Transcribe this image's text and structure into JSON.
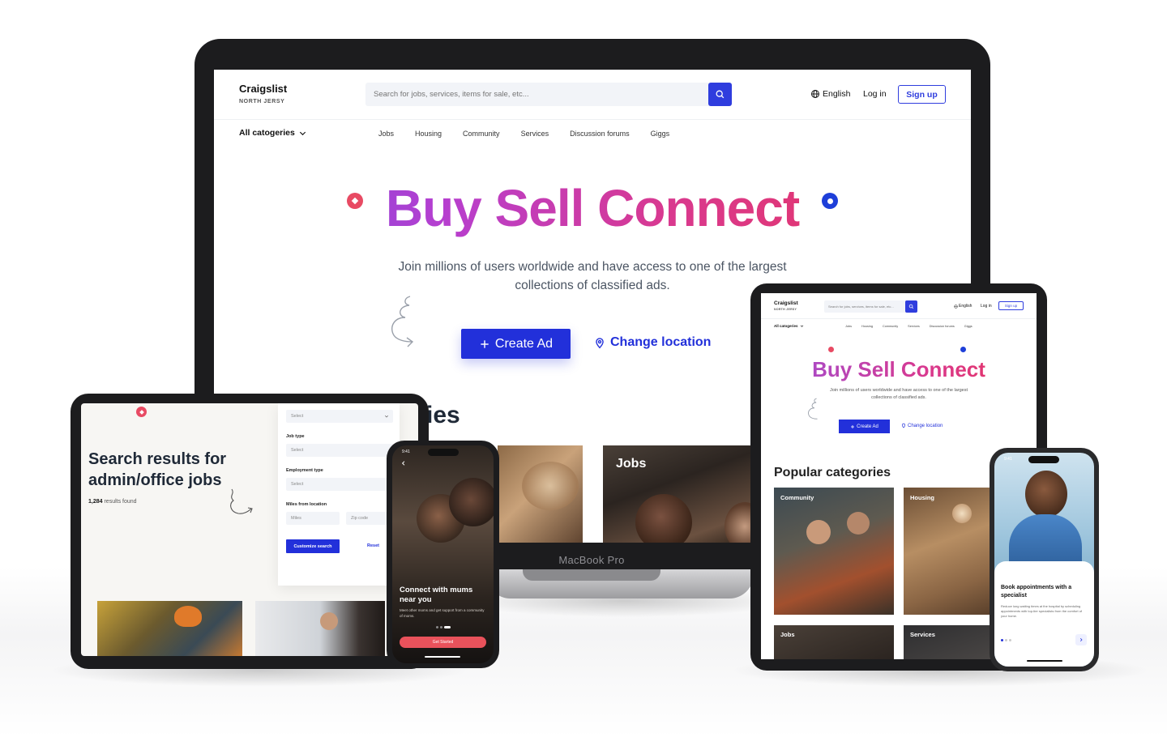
{
  "desktop": {
    "brand_name": "Craigslist",
    "brand_region": "NORTH JERSY",
    "search_placeholder": "Search for jobs, services, items for sale, etc...",
    "language": "English",
    "login": "Log in",
    "signup": "Sign up",
    "all_categories": "All catogeries",
    "nav": [
      "Jobs",
      "Housing",
      "Community",
      "Services",
      "Discussion forums",
      "Giggs"
    ],
    "hero_title": "Buy Sell Connect",
    "hero_subtitle": "Join millions of users worldwide and have access to one of the largest collections of classified ads.",
    "create_ad": "Create Ad",
    "change_location": "Change location",
    "categories_title_fragment": "ies",
    "category_jobs": "Jobs",
    "device_label": "MacBook Pro"
  },
  "tablet_left": {
    "title": "Search results for admin/office jobs",
    "count_number": "1,284",
    "count_text": " results found",
    "select_placeholder": "Select",
    "job_type_label": "Job type",
    "employment_type_label": "Employment type",
    "miles_label": "Miles from location",
    "miles_placeholder": "Miles",
    "zip_placeholder": "Zip code",
    "customize_button": "Customize search",
    "reset_button": "Reset"
  },
  "phone_left": {
    "time": "9:41",
    "title": "Connect with mums near you",
    "subtitle": "Meet other moms and get support from a community of moms.",
    "cta": "Get Started"
  },
  "tablet_right": {
    "brand_name": "Craigslist",
    "brand_region": "NORTH JERSY",
    "search_placeholder": "Search for jobs, services, items for sale, etc...",
    "language": "English",
    "login": "Log in",
    "signup": "Sign up",
    "all_categories": "All catogeries",
    "nav": [
      "Jobs",
      "Housing",
      "Community",
      "Services",
      "Discussion forums",
      "Giggs"
    ],
    "hero_title": "Buy Sell Connect",
    "hero_subtitle": "Join millions of users worldwide and have access to one of the largest collections of classified ads.",
    "create_ad": "Create Ad",
    "change_location": "Change location",
    "popular_title": "Popular categories",
    "categories": [
      "Community",
      "Housing",
      "Jobs",
      "Services"
    ]
  },
  "phone_right": {
    "time": "9:41",
    "title": "Book appointments with a specialist",
    "subtitle": "Reduce long waiting times at the hospital by scheduling appointments with top-tier specialists from the comfort of your home."
  },
  "colors": {
    "primary": "#2230da",
    "accent_red": "#e84a63",
    "accent_blue": "#1e3fd9",
    "gradient_start": "#6b4fe0",
    "gradient_end": "#e8345a",
    "cta_red": "#e9525b"
  },
  "icons": [
    "search-icon",
    "globe-icon",
    "chevron-down-icon",
    "plus-icon",
    "location-pin-icon",
    "squiggle-doodle",
    "chevron-right-icon",
    "back-arrow-icon"
  ]
}
